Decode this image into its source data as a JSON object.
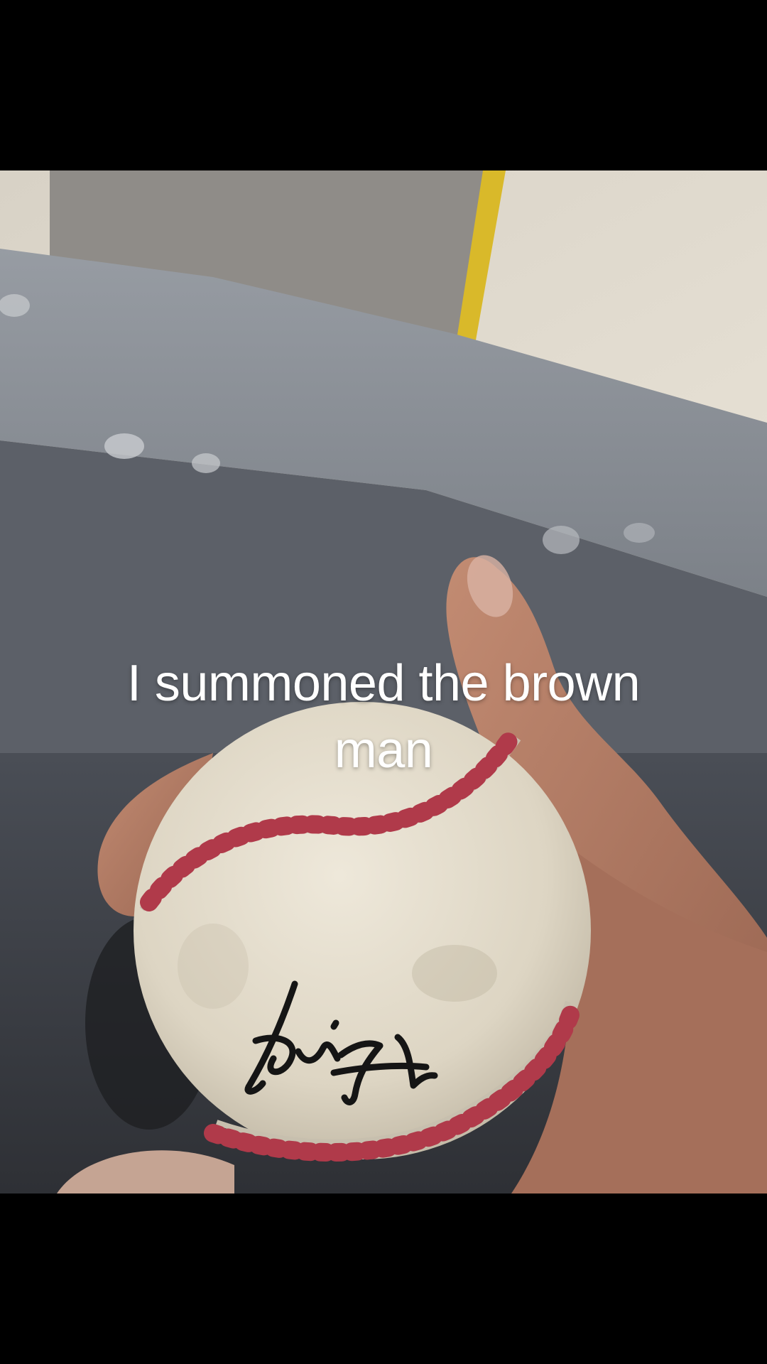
{
  "caption": {
    "text": "I summoned the brown man"
  },
  "photo": {
    "subject": "signed-baseball-in-hand",
    "colors": {
      "letterbox": "#000000",
      "wall": "#e3ddd1",
      "concrete_ledge": "#8b9097",
      "shadow_floor": "#3c3f45",
      "yellow_stripe": "#d9b92a",
      "ball": "#e4ddcc",
      "stitching": "#b03a4a",
      "skin": "#b07a63",
      "signature_ink": "#151515"
    }
  }
}
